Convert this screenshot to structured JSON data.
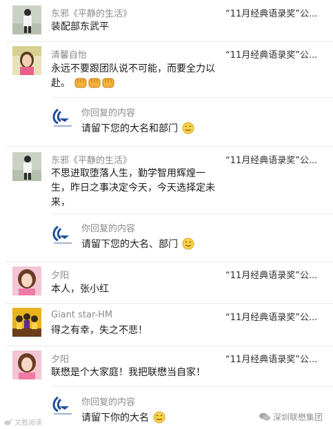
{
  "comments": [
    {
      "name": "东邪《平静的生活》",
      "ref": "“11月经典语录奖”公...",
      "text": "装配部东武平",
      "avatar": "avatar-man-standing"
    },
    {
      "name": "清馨自怡",
      "ref": "“11月经典语录奖”公...",
      "text": "永远不要跟团队说不可能，而要全力以赴。",
      "emoji_count": 3,
      "avatar": "avatar-woman-portrait",
      "reply": {
        "label": "你回复的内容",
        "text": "请留下您的大名和部门"
      }
    },
    {
      "name": "东邪《平静的生活》",
      "ref": "“11月经典语录奖”公...",
      "text": "不思进取堕落人生，勤学智用辉煌一生，昨日之事决定今天，今天选择定未来，",
      "avatar": "avatar-man-standing",
      "reply": {
        "label": "你回复的内容",
        "text": "请留下您的大名、部门"
      }
    },
    {
      "name": "夕阳",
      "ref": "“11月经典语录奖”公...",
      "text": "本人，张小红",
      "avatar": "avatar-girl-pink"
    },
    {
      "name": "Giant star-HM",
      "ref": "“11月经典语录奖”公...",
      "text": "得之有幸，失之不悲！",
      "avatar": "avatar-basketball-team"
    },
    {
      "name": "夕阳",
      "ref": "“11月经典语录奖”公...",
      "text": "联懋是个大家庭！我把联懋当自家！",
      "avatar": "avatar-girl-pink",
      "reply": {
        "label": "你回复的内容",
        "text": "请留下你的大名"
      }
    }
  ],
  "watermark_left": "文胜阅读",
  "watermark_right": "深圳联懋集团",
  "colors": {
    "name": "#8a8a8a",
    "text": "#1a1a1a",
    "brand_blue": "#1c4f9c",
    "separator": "#ececec"
  }
}
